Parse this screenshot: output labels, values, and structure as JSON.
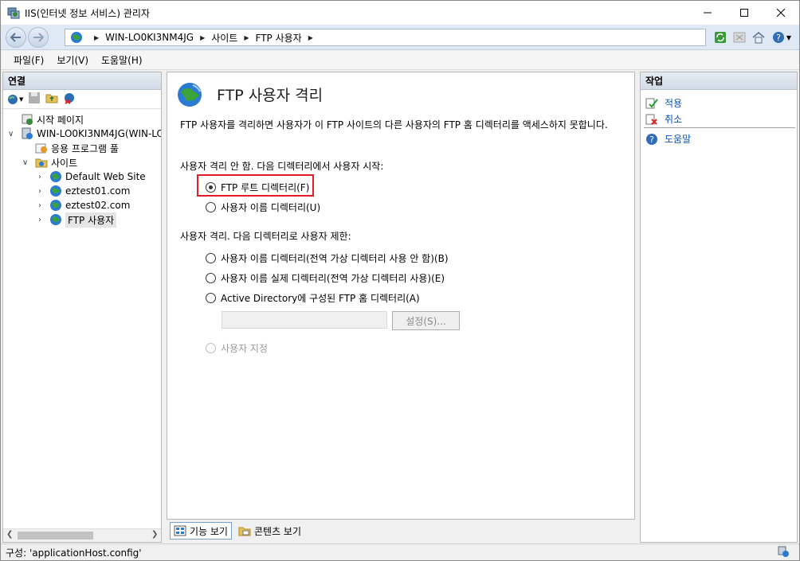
{
  "window": {
    "title": "IIS(인터넷 정보 서비스) 관리자"
  },
  "address": {
    "crumbs": [
      "WIN-LO0KI3NM4JG",
      "사이트",
      "FTP 사용자"
    ]
  },
  "menu": {
    "file": "파일(F)",
    "view": "보기(V)",
    "help": "도움말(H)"
  },
  "connections": {
    "header": "연결",
    "tree": {
      "start_page": "시작 페이지",
      "server": "WIN-LO0KI3NM4JG(WIN-LO",
      "app_pools": "응용 프로그램 풀",
      "sites": "사이트",
      "site1": "Default Web Site",
      "site2": "eztest01.com",
      "site3": "eztest02.com",
      "site4": "FTP 사용자"
    }
  },
  "main": {
    "title": "FTP 사용자 격리",
    "description": "FTP 사용자를 격리하면 사용자가 이 FTP 사이트의 다른 사용자의 FTP 홈 디렉터리를 액세스하지 못합니다.",
    "section_no_isolation": "사용자 격리 안 함. 다음 디렉터리에서 사용자 시작:",
    "opt_ftp_root": "FTP 루트 디렉터리(F)",
    "opt_user_dir": "사용자 이름 디렉터리(U)",
    "section_isolation": "사용자 격리. 다음 디렉터리로 사용자 제한:",
    "opt_user_dir_no_global": "사용자 이름 디렉터리(전역 가상 디렉터리 사용 안 함)(B)",
    "opt_user_physical_dir": "사용자 이름 실제 디렉터리(전역 가상 디렉터리 사용)(E)",
    "opt_active_directory": "Active Directory에 구성된 FTP 홈 디렉터리(A)",
    "settings_button": "설정(S)...",
    "opt_custom": "사용자 지정",
    "selected_option": "FTP 루트 디렉터리(F)"
  },
  "view_tabs": {
    "features": "기능 보기",
    "content": "콘텐츠 보기"
  },
  "actions": {
    "header": "작업",
    "apply": "적용",
    "cancel": "취소",
    "help": "도움말"
  },
  "status": {
    "text": "구성: 'applicationHost.config'"
  },
  "colors": {
    "highlight_border": "#e31b23",
    "link": "#0b55b6"
  }
}
